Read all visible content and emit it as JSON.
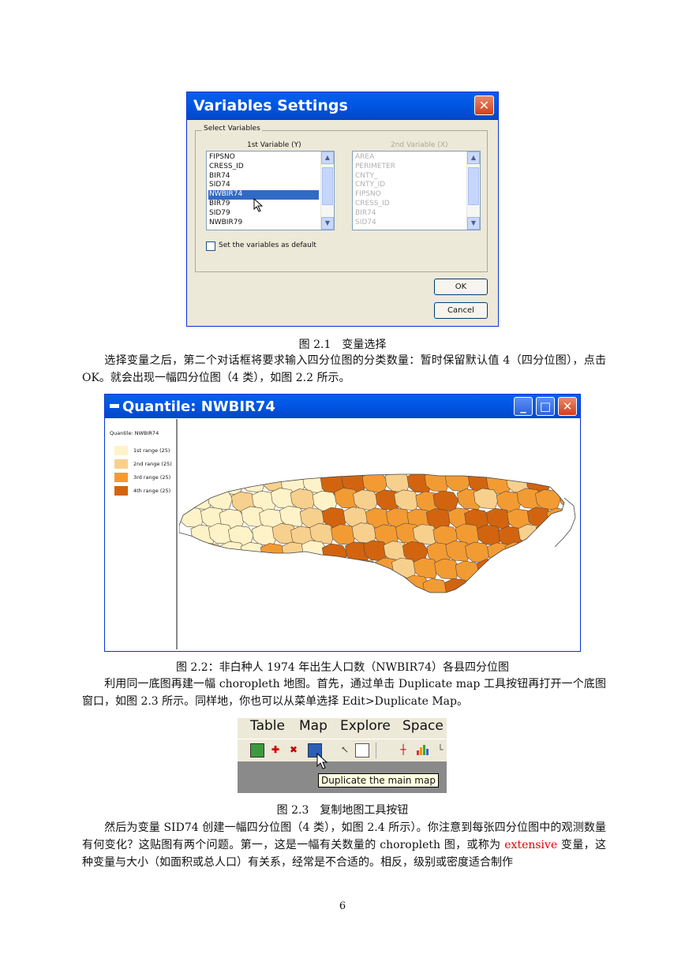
{
  "fig1": {
    "dialog_title": "Variables Settings",
    "close": "✕",
    "group_label": "Select Variables",
    "col1_label": "1st Variable (Y)",
    "col2_label": "2nd Variable (X)",
    "list1": [
      "FIPSNO",
      "CRESS_ID",
      "BIR74",
      "SID74",
      "NWBIR74",
      "BIR79",
      "SID79",
      "NWBIR79"
    ],
    "list1_selected": "NWBIR74",
    "list2": [
      "AREA",
      "PERIMETER",
      "CNTY_",
      "CNTY_ID",
      "FIPSNO",
      "CRESS_ID",
      "BIR74",
      "SID74"
    ],
    "default_checkbox": "Set the variables as default",
    "ok": "OK",
    "cancel": "Cancel",
    "caption": "图 2.1　变量选择"
  },
  "para1": "选择变量之后，第二个对话框将要求输入四分位图的分类数量：暂时保留默认值 4（四分位图），点击 OK。就会出现一幅四分位图（4 类），如图 2.2 所示。",
  "fig2": {
    "window_title": "Quantile: NWBIR74",
    "legend_title": "Quantile: NWBIR74",
    "legend": [
      {
        "label": "1st range (25)",
        "color": "#fef3c8"
      },
      {
        "label": "2nd range (25)",
        "color": "#f8d08e"
      },
      {
        "label": "3rd range (25)",
        "color": "#f39b33"
      },
      {
        "label": "4th range (25)",
        "color": "#d2640f"
      }
    ],
    "caption": "图 2.2：非白种人 1974 年出生人口数（NWBIR74）各县四分位图"
  },
  "para2": "利用同一底图再建一幅 choropleth 地图。首先，通过单击 Duplicate map 工具按钮再打开一个底图窗口，如图 2.3 所示。同样地，你也可以从菜单选择 Edit>Duplicate Map。",
  "fig3": {
    "menu": [
      "Table",
      "Map",
      "Explore",
      "Space"
    ],
    "tooltip": "Duplicate the main map",
    "caption": "图 2.3　复制地图工具按钮"
  },
  "para3_a": "然后为变量 SID74 创建一幅四分位图（4 类），如图 2.4 所示）。你注意到每张四分位图中的观测数量有何变化？这贴图有两个问题。第一，这是一幅有关数量的 choropleth 图，或称为 ",
  "para3_red": "extensive",
  "para3_b": " 变量，这种变量与大小（如面积或总人口）有关系，经常是不合适的。相反，级别或密度适合制作",
  "page_number": "6"
}
